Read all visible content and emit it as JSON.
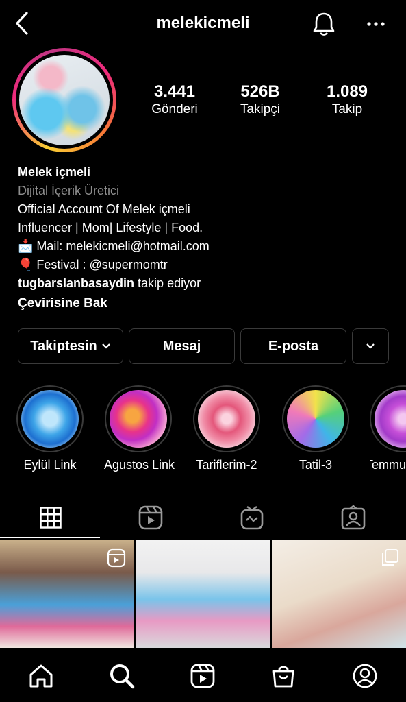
{
  "header": {
    "username": "melekicmeli"
  },
  "stats": {
    "posts_value": "3.441",
    "posts_label": "Gönderi",
    "followers_value": "526B",
    "followers_label": "Takipçi",
    "following_value": "1.089",
    "following_label": "Takip"
  },
  "bio": {
    "name": "Melek içmeli",
    "category": "Dijital İçerik Üretici",
    "line1": "Official Account Of Melek içmeli",
    "line2": "Influencer | Mom| Lifestyle | Food.",
    "line3_emoji": "📩",
    "line3": " Mail: melekicmeli@hotmail.com",
    "line4_emoji": "🎈",
    "line4": " Festival : @supermomtr",
    "followed_by_user": "tugbarslanbasaydin",
    "followed_by_suffix": " takip ediyor",
    "translate": "Çevirisine Bak"
  },
  "actions": {
    "following": "Takiptesin",
    "message": "Mesaj",
    "email": "E-posta"
  },
  "highlights": [
    {
      "label": "Eylül Link"
    },
    {
      "label": "Agustos Link"
    },
    {
      "label": "Tariflerim-2"
    },
    {
      "label": "Tatil-3"
    },
    {
      "label": "Temmu"
    }
  ],
  "tabs": [
    "grid-icon",
    "reels-icon",
    "igtv-icon",
    "tagged-icon"
  ],
  "bottom_nav": [
    "home-icon",
    "search-icon",
    "reels-icon",
    "shop-icon",
    "profile-icon"
  ]
}
